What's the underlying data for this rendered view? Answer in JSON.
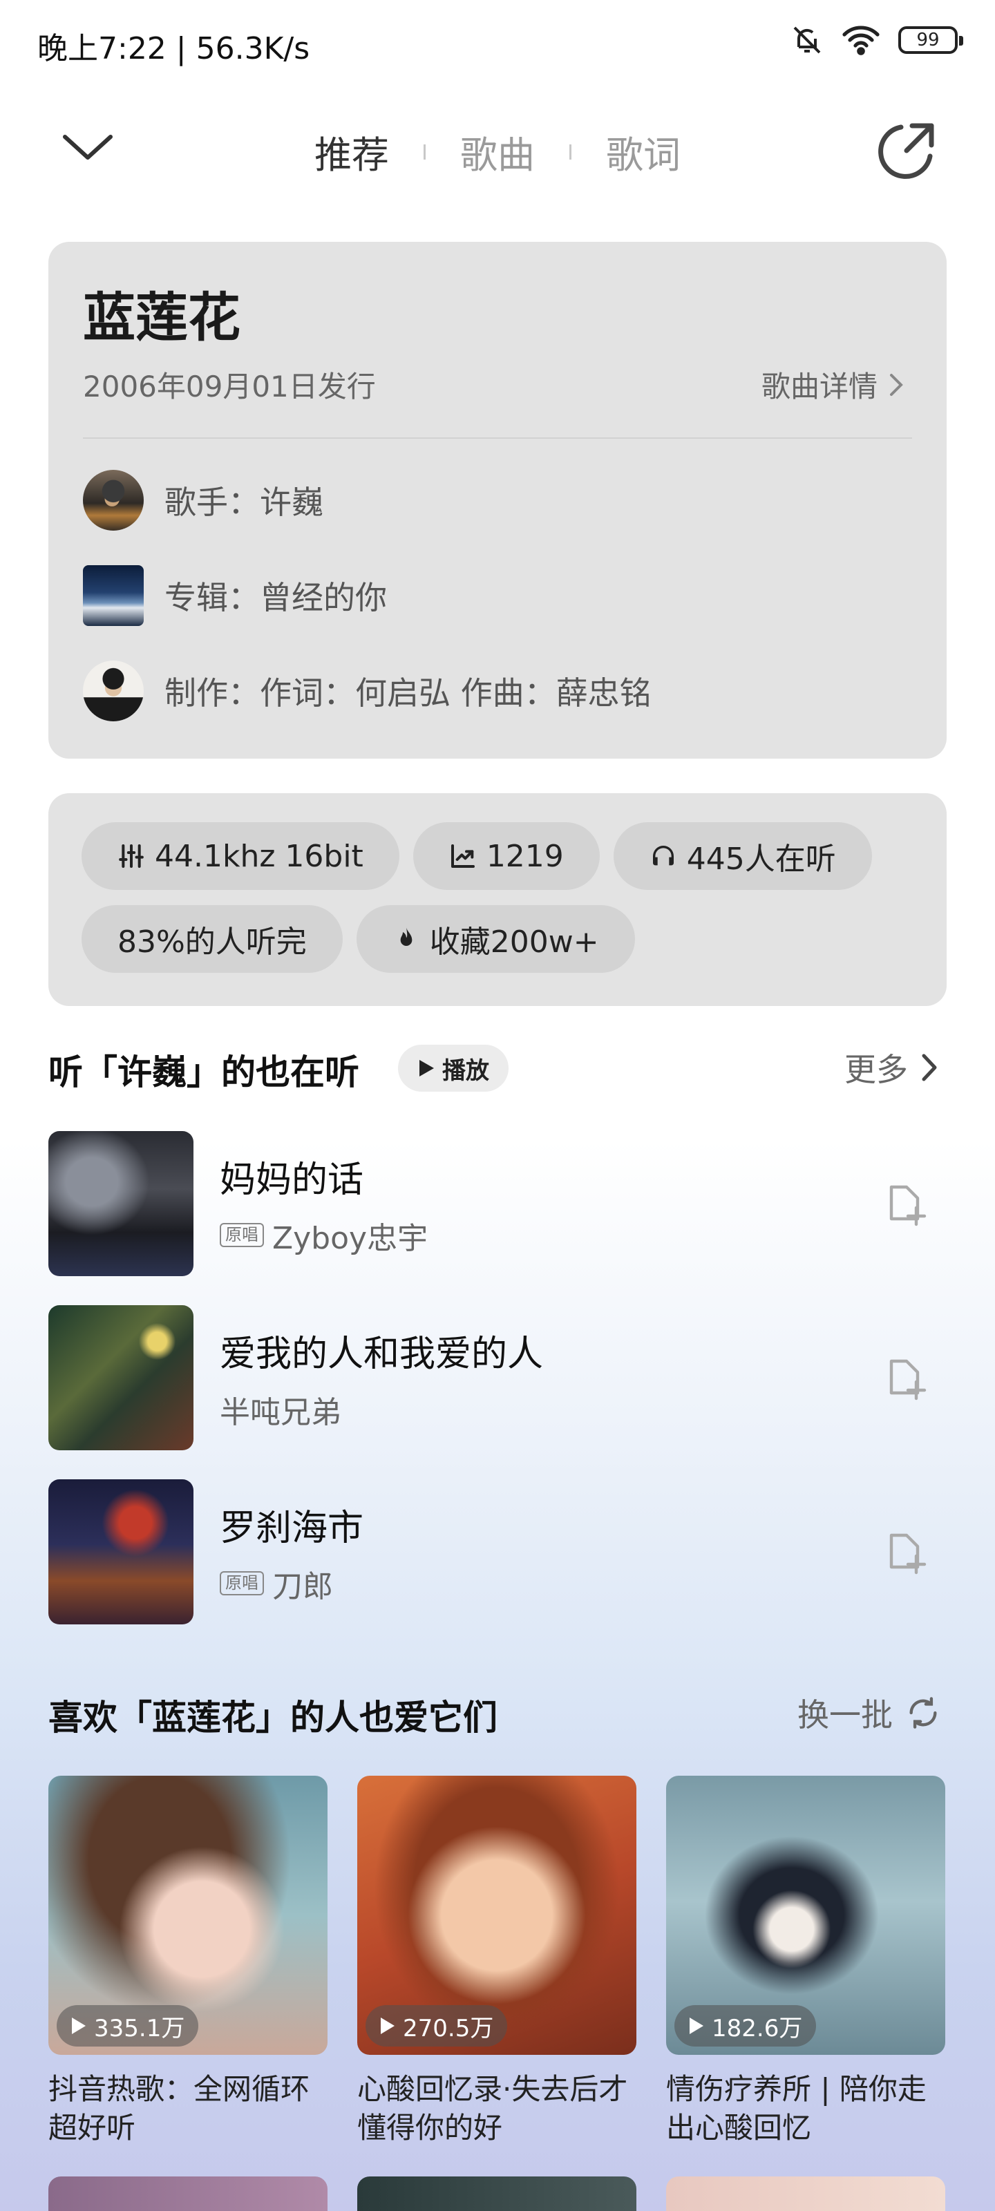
{
  "status_bar": {
    "time_speed": "晚上7:22 | 56.3K/s",
    "battery": "99"
  },
  "header": {
    "tabs": [
      {
        "label": "推荐",
        "active": true
      },
      {
        "label": "歌曲",
        "active": false
      },
      {
        "label": "歌词",
        "active": false
      }
    ],
    "icons": {
      "back": "chevron-down-icon",
      "share": "share-icon"
    }
  },
  "song": {
    "title": "蓝莲花",
    "release": "2006年09月01日发行",
    "detail_link": "歌曲详情",
    "singer": "歌手：许巍",
    "album": "专辑：曾经的你",
    "credits": "制作：作词：何启弘   作曲：薛忠铭"
  },
  "stats": {
    "chips": [
      {
        "icon": "equalizer-icon",
        "label": "44.1khz  16bit"
      },
      {
        "icon": "trend-icon",
        "label": "1219"
      },
      {
        "icon": "headphones-icon",
        "label": "445人在听"
      },
      {
        "icon": "",
        "label": "83%的人听完"
      },
      {
        "icon": "fire-icon",
        "label": "收藏200w+"
      }
    ]
  },
  "also_listen": {
    "title": "听「许巍」的也在听",
    "play_label": "播放",
    "more_label": "更多",
    "songs": [
      {
        "name": "妈妈的话",
        "tag": "原唱",
        "artist": "Zyboy忠宇"
      },
      {
        "name": "爱我的人和我爱的人",
        "tag": "",
        "artist": "半吨兄弟"
      },
      {
        "name": "罗刹海市",
        "tag": "原唱",
        "artist": "刀郎"
      }
    ]
  },
  "playlists": {
    "title": "喜欢「蓝莲花」的人也爱它们",
    "refresh_label": "换一批",
    "items": [
      {
        "count": "335.1万",
        "title_line1": "抖音热歌：全网循环",
        "title_line2": "超好听"
      },
      {
        "count": "270.5万",
        "title_line1": "心酸回忆录·失去后才",
        "title_line2": "懂得你的好"
      },
      {
        "count": "182.6万",
        "title_line1": "情伤疗养所 | 陪你走",
        "title_line2": "出心酸回忆"
      }
    ]
  },
  "colors": {
    "card_bg": "#e3e3e3",
    "chip_bg": "#d3d3d3",
    "accent_text": "#111111",
    "muted_text": "#666666"
  }
}
